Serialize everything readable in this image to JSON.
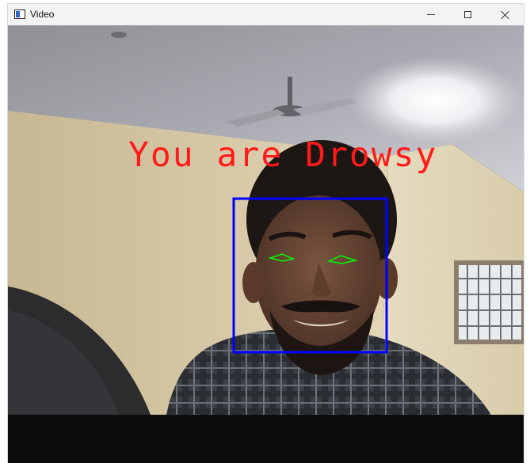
{
  "window": {
    "title": "Video",
    "controls": [
      "minimize",
      "maximize",
      "close"
    ]
  },
  "icons": {
    "app": "app-window-icon",
    "minimize": "minimize-icon",
    "maximize": "maximize-icon",
    "close": "close-icon"
  },
  "video": {
    "alert_text": "You are Drowsy",
    "colors": {
      "alert": "#ff1a1a",
      "face_box": "#0000ff",
      "eye_contour": "#00ff00"
    }
  }
}
